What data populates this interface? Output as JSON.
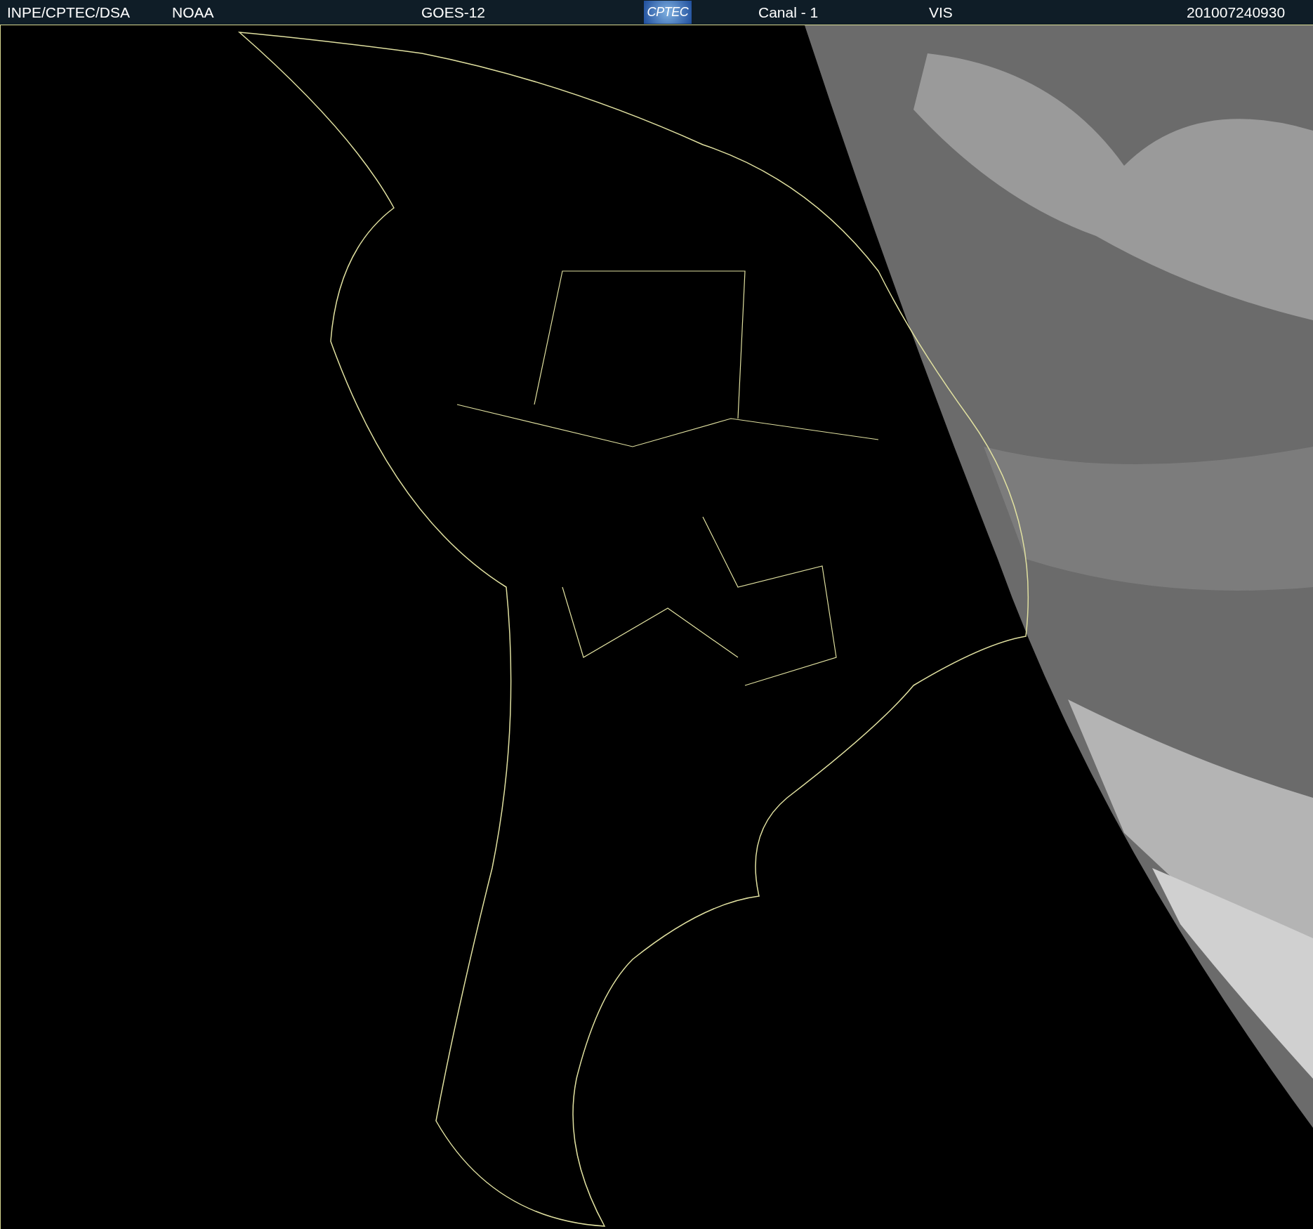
{
  "header": {
    "items": [
      {
        "kind": "text",
        "text": "INPE/CPTEC/DSA"
      },
      {
        "kind": "text",
        "text": "NOAA"
      },
      {
        "kind": "text",
        "text": "GOES-12"
      },
      {
        "kind": "logo",
        "text": "CPTEC"
      },
      {
        "kind": "text",
        "text": "Canal - 1"
      },
      {
        "kind": "text",
        "text": "VIS"
      },
      {
        "kind": "text",
        "text": "201007240930"
      }
    ]
  }
}
